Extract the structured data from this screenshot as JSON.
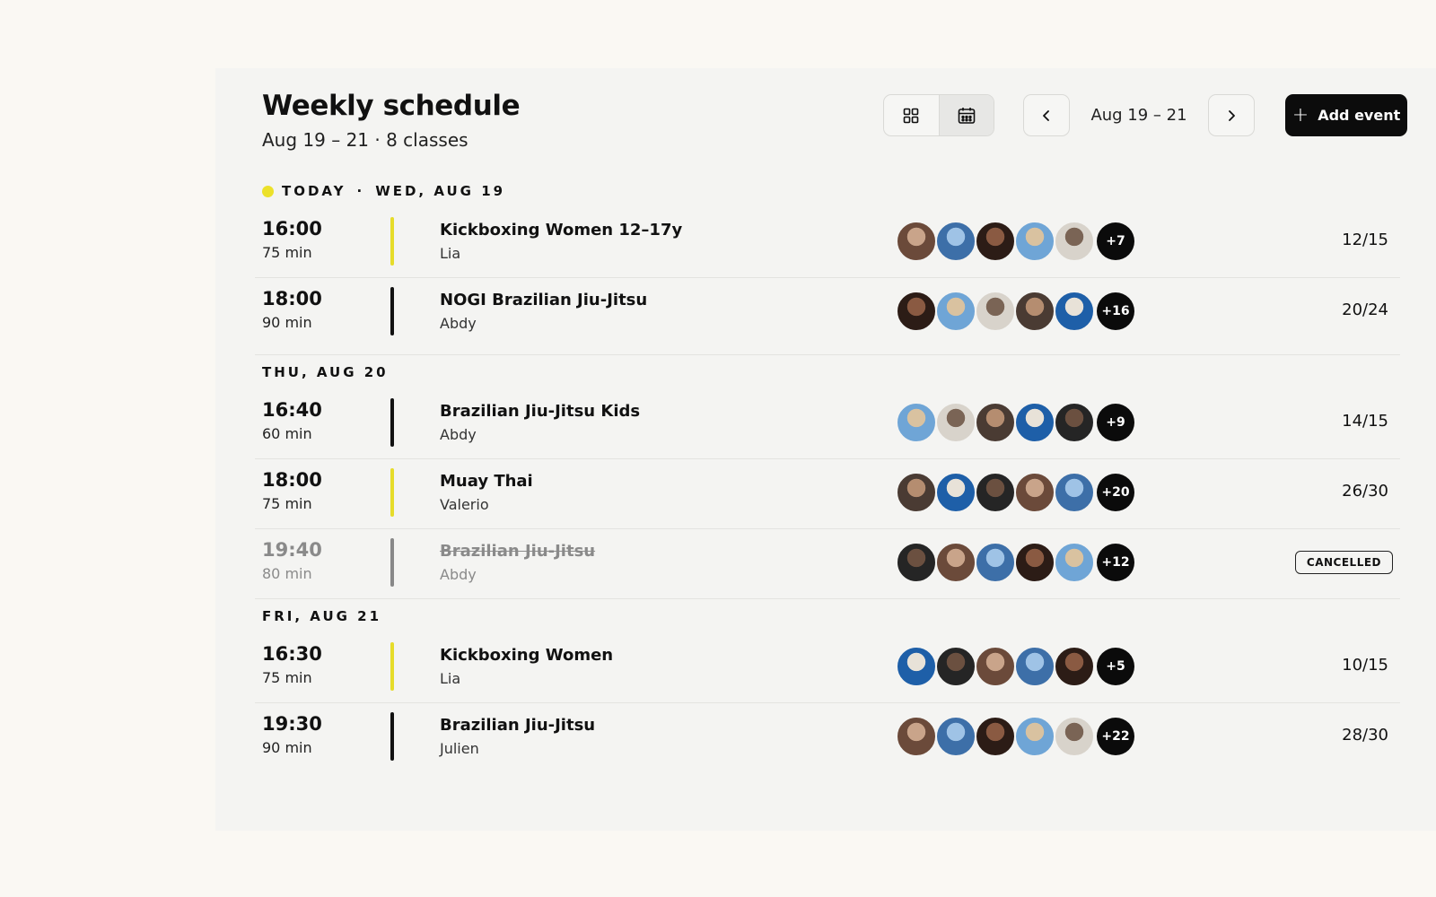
{
  "header": {
    "title": "Weekly schedule",
    "subtitle": "Aug 19 – 21 · 8 classes"
  },
  "toolbar": {
    "view_grid_icon": "grid-icon",
    "view_calendar_icon": "calendar-icon",
    "range": "Aug 19 – 21",
    "add_label": "Add event"
  },
  "colors": {
    "accent_yellow": "#e6dc2a",
    "primary": "#0c0c0c",
    "background": "#faf8f3"
  },
  "days": [
    {
      "today_label": "TODAY",
      "label": "WED, AUG 19",
      "classes": [
        {
          "time": "16:00",
          "duration": "75 min",
          "name": "Kickboxing Women 12–17y",
          "coach": "Lia",
          "extra": "+7",
          "capacity": "12/15",
          "accent": "yellow"
        },
        {
          "time": "18:00",
          "duration": "90 min",
          "name": "NOGI Brazilian Jiu-Jitsu",
          "coach": "Abdy",
          "extra": "+16",
          "capacity": "20/24",
          "accent": "black"
        }
      ]
    },
    {
      "label": "THU, AUG 20",
      "classes": [
        {
          "time": "16:40",
          "duration": "60 min",
          "name": "Brazilian Jiu-Jitsu Kids",
          "coach": "Abdy",
          "extra": "+9",
          "capacity": "14/15",
          "accent": "black"
        },
        {
          "time": "18:00",
          "duration": "75 min",
          "name": "Muay Thai",
          "coach": "Valerio",
          "extra": "+20",
          "capacity": "26/30",
          "accent": "yellow"
        },
        {
          "time": "19:40",
          "duration": "80 min",
          "name": "Brazilian Jiu-Jitsu",
          "coach": "Abdy",
          "extra": "+12",
          "status": "CANCELLED",
          "accent": "grey"
        }
      ]
    },
    {
      "label": "FRI, AUG 21",
      "classes": [
        {
          "time": "16:30",
          "duration": "75 min",
          "name": "Kickboxing Women",
          "coach": "Lia",
          "extra": "+5",
          "capacity": "10/15",
          "accent": "yellow"
        },
        {
          "time": "19:30",
          "duration": "90 min",
          "name": "Brazilian Jiu-Jitsu",
          "coach": "Julien",
          "extra": "+22",
          "capacity": "28/30",
          "accent": "black"
        }
      ]
    }
  ]
}
